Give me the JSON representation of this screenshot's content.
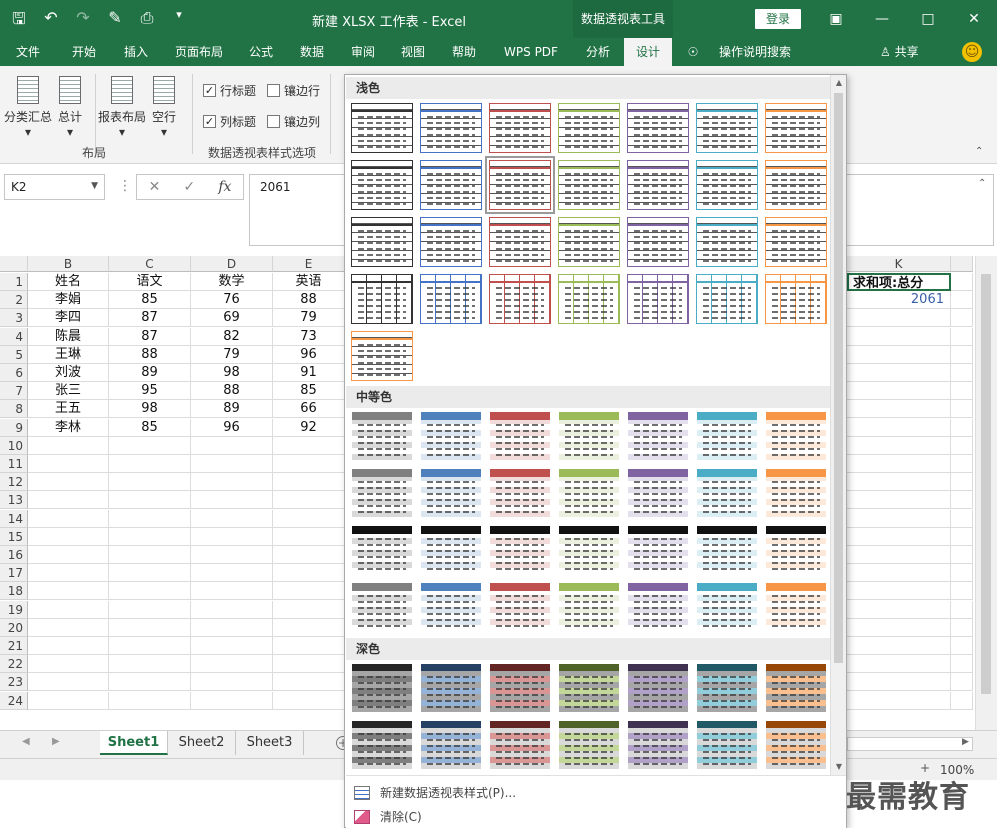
{
  "title_bar": {
    "title": "新建 XLSX 工作表  -  Excel",
    "context_tab": "数据透视表工具",
    "login": "登录",
    "icons": [
      "save-icon",
      "undo-icon",
      "redo-icon",
      "format-painter-icon",
      "print-preview-icon",
      "customize-qat-icon"
    ]
  },
  "ribbon_tabs": [
    {
      "label": "文件"
    },
    {
      "label": "开始"
    },
    {
      "label": "插入"
    },
    {
      "label": "页面布局"
    },
    {
      "label": "公式"
    },
    {
      "label": "数据"
    },
    {
      "label": "审阅"
    },
    {
      "label": "视图"
    },
    {
      "label": "帮助"
    },
    {
      "label": "WPS PDF"
    },
    {
      "label": "分析"
    },
    {
      "label": "设计"
    },
    {
      "label": "操作说明搜索"
    }
  ],
  "share_label": "共享",
  "ribbon": {
    "layout_buttons": [
      "分类汇总",
      "总计",
      "报表布局",
      "空行"
    ],
    "layout_group_label": "布局",
    "options": [
      {
        "label": "行标题",
        "checked": true
      },
      {
        "label": "镶边行",
        "checked": false
      },
      {
        "label": "列标题",
        "checked": true
      },
      {
        "label": "镶边列",
        "checked": false
      }
    ],
    "options_group_label": "数据透视表样式选项"
  },
  "formula_bar": {
    "name_box": "K2",
    "formula": "2061",
    "fx": "fx"
  },
  "columns": [
    "B",
    "C",
    "D",
    "E",
    "K"
  ],
  "rows": [
    "1",
    "2",
    "3",
    "4",
    "5",
    "6",
    "7",
    "8",
    "9",
    "10",
    "11",
    "12",
    "13",
    "14",
    "15",
    "16",
    "17",
    "18",
    "19",
    "20",
    "21",
    "22",
    "23",
    "24"
  ],
  "table": {
    "headers": [
      "姓名",
      "语文",
      "数学",
      "英语"
    ],
    "data": [
      [
        "李娟",
        "85",
        "76",
        "88"
      ],
      [
        "李四",
        "87",
        "69",
        "79"
      ],
      [
        "陈晨",
        "87",
        "82",
        "73"
      ],
      [
        "王琳",
        "88",
        "79",
        "96"
      ],
      [
        "刘波",
        "89",
        "98",
        "91"
      ],
      [
        "张三",
        "95",
        "88",
        "85"
      ],
      [
        "王五",
        "98",
        "89",
        "66"
      ],
      [
        "李林",
        "85",
        "96",
        "92"
      ]
    ],
    "k_header": "求和项:总分",
    "k_value": "2061"
  },
  "sheets": [
    {
      "label": "Sheet1",
      "active": true
    },
    {
      "label": "Sheet2",
      "active": false
    },
    {
      "label": "Sheet3",
      "active": false
    }
  ],
  "status": {
    "zoom": "100%"
  },
  "gallery": {
    "sections": [
      "浅色",
      "中等色",
      "深色"
    ],
    "footer": [
      "新建数据透视表样式(P)...",
      "清除(C)"
    ]
  },
  "watermark": "最需教育",
  "colors": {
    "excel_green": "#217346",
    "light_palette": [
      "#333333",
      "#4472c4",
      "#c0504d",
      "#9bbb59",
      "#8064a2",
      "#4bacc6",
      "#f79646"
    ]
  }
}
